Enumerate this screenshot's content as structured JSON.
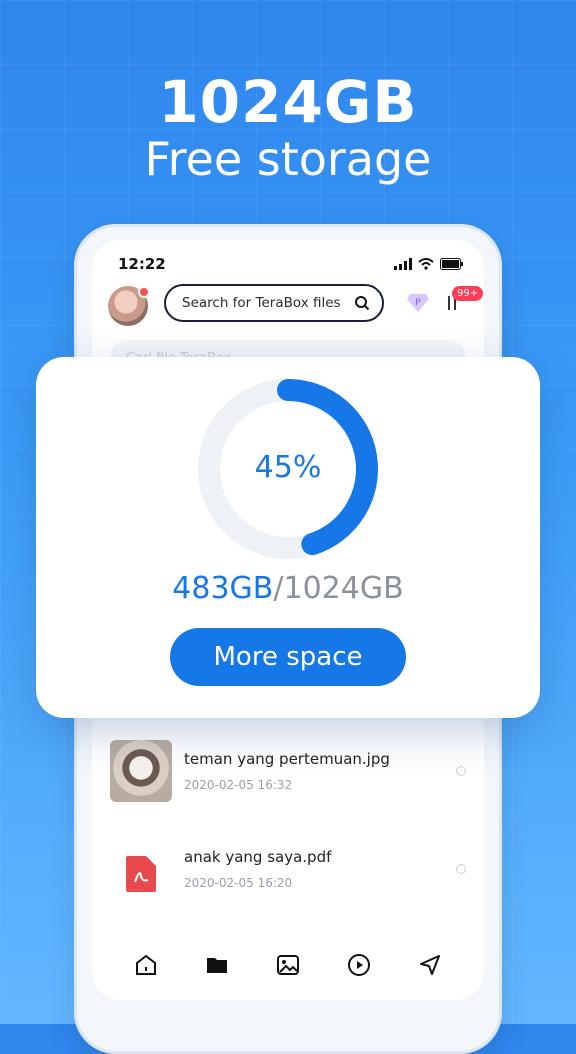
{
  "headline": {
    "line1": "1024GB",
    "line2": "Free storage"
  },
  "status_bar": {
    "time": "12:22"
  },
  "header": {
    "search_placeholder": "Search for TeraBox files",
    "badge": "99+",
    "ghost_search": "Cari file TeraBox"
  },
  "storage": {
    "percent_label": "45%",
    "percent_value": 0.45,
    "used": "483GB",
    "separator": "/",
    "total": "1024GB",
    "button_label": "More space",
    "accent_color": "#1677e6"
  },
  "files": [
    {
      "name": "teman yang pertemuan.jpg",
      "date": "2020-02-05  16:32",
      "type": "image"
    },
    {
      "name": "anak yang saya.pdf",
      "date": "2020-02-05  16:20",
      "type": "pdf"
    }
  ],
  "tabs": [
    "home-icon",
    "folder-icon",
    "photo-icon",
    "play-icon",
    "send-icon"
  ]
}
